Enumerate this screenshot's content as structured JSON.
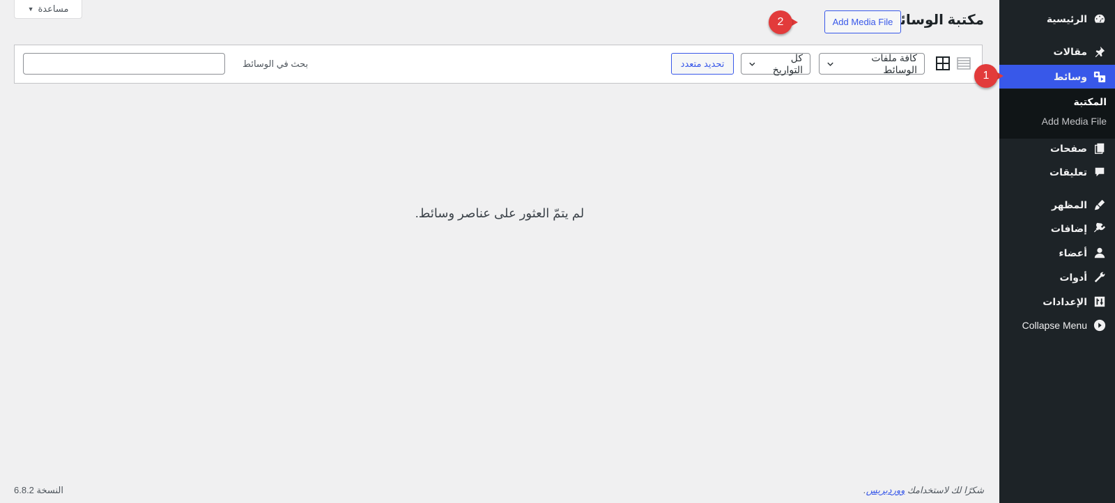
{
  "help": {
    "label": "مساعدة",
    "caret": "▼"
  },
  "header": {
    "title": "مكتبة الوسائط",
    "add_button": "Add Media File"
  },
  "toolbar": {
    "type_filter": "كافة ملفات الوسائط",
    "date_filter": "كل التواريخ",
    "bulk_select": "تحديد متعدد",
    "search_label": "بحث في الوسائط",
    "search_value": ""
  },
  "main": {
    "empty_message": "لم يتمّ العثور على عناصر وسائط."
  },
  "footer": {
    "thanks_prefix": "شكرًا لك لاستخدامك ",
    "thanks_link": "ووردبريس",
    "thanks_suffix": ".",
    "version": "النسخة 6.8.2"
  },
  "sidebar": {
    "items": [
      {
        "label": "الرئيسية",
        "icon": "dashboard-icon"
      },
      {
        "label": "مقالات",
        "icon": "pin-icon"
      },
      {
        "label": "وسائط",
        "icon": "media-icon",
        "active": true
      },
      {
        "label": "صفحات",
        "icon": "pages-icon"
      },
      {
        "label": "تعليقات",
        "icon": "comment-icon"
      },
      {
        "label": "المظهر",
        "icon": "brush-icon"
      },
      {
        "label": "إضافات",
        "icon": "plugin-icon"
      },
      {
        "label": "أعضاء",
        "icon": "user-icon"
      },
      {
        "label": "أدوات",
        "icon": "wrench-icon"
      },
      {
        "label": "الإعدادات",
        "icon": "settings-icon"
      },
      {
        "label": "Collapse Menu",
        "icon": "collapse-icon"
      }
    ],
    "submenu": [
      {
        "label": "المكتبة",
        "current": true
      },
      {
        "label": "Add Media File"
      }
    ]
  },
  "markers": {
    "step1": "1",
    "step2": "2"
  },
  "colors": {
    "sidebar_bg": "#1d2327",
    "accent": "#3858e9",
    "marker": "#e23b3b",
    "page_bg": "#f0f0f1"
  }
}
